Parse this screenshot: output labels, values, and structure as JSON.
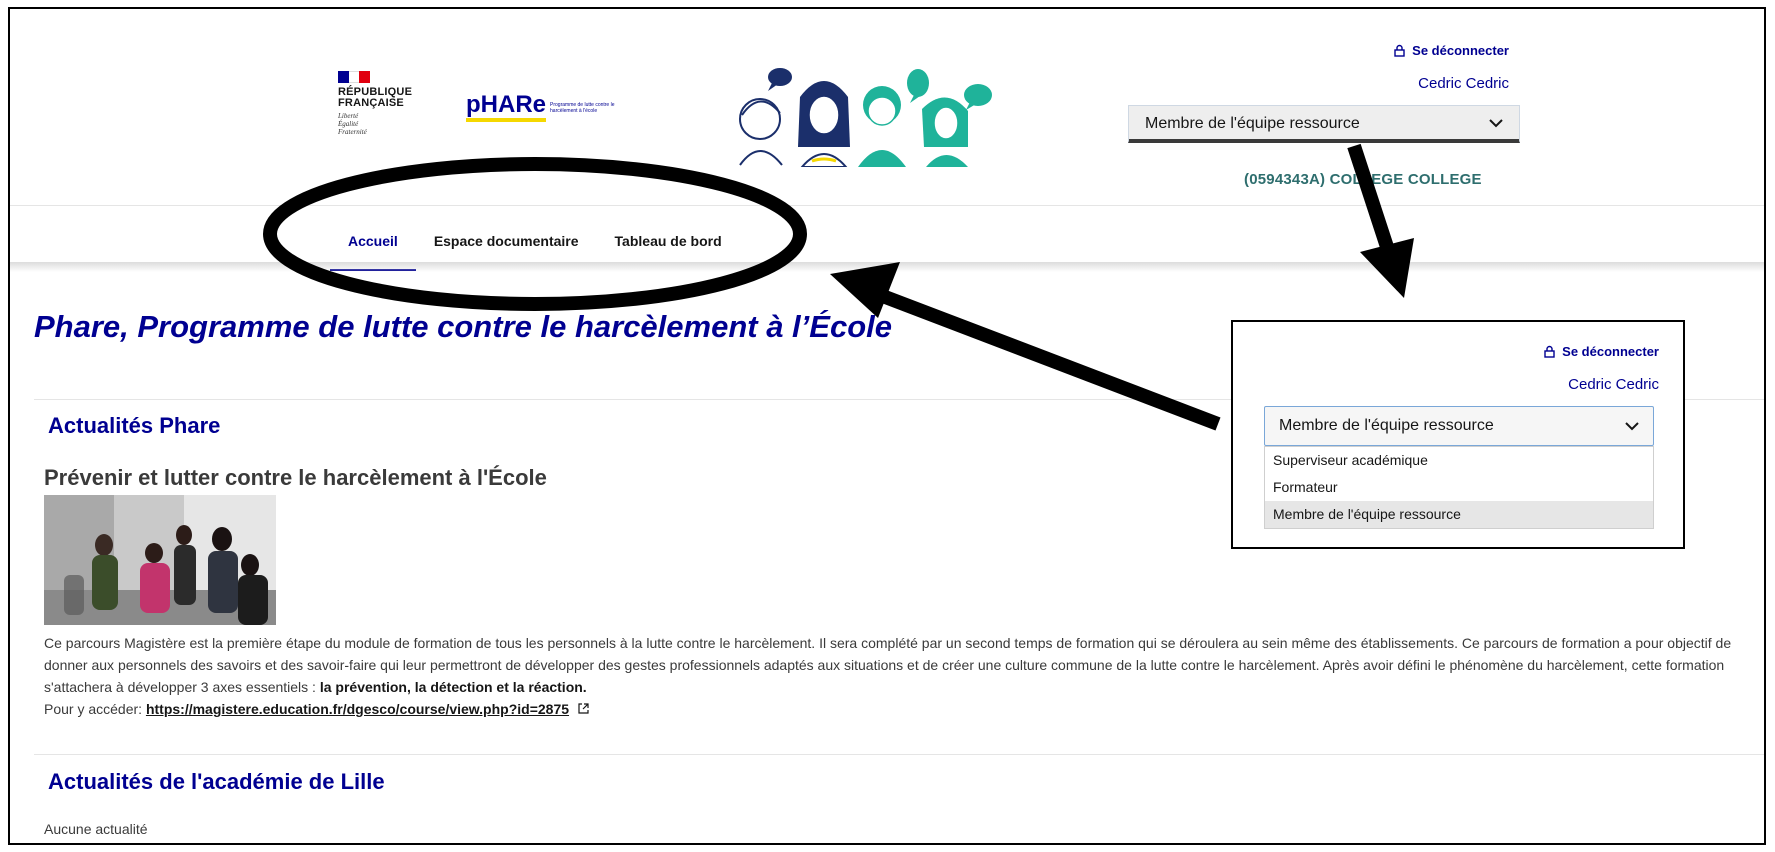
{
  "header": {
    "republic_name_line1": "RÉPUBLIQUE",
    "republic_name_line2": "FRANÇAISE",
    "republic_motto": [
      "Liberté",
      "Égalité",
      "Fraternité"
    ],
    "phare_logo_word": "pHARe",
    "phare_logo_tagline": "Programme de lutte contre le harcèlement à l'école",
    "logout_label": "Se déconnecter",
    "user_name": "Cedric Cedric",
    "role_selected": "Membre de l'équipe ressource",
    "establishment": "(0594343A) COLLEGE COLLEGE"
  },
  "nav": {
    "items": [
      {
        "label": "Accueil",
        "active": true
      },
      {
        "label": "Espace documentaire",
        "active": false
      },
      {
        "label": "Tableau de bord",
        "active": false
      }
    ]
  },
  "main": {
    "page_title": "Phare, Programme de lutte contre le harcèlement à l’École",
    "news_heading": "Actualités Phare",
    "article_title": "Prévenir et lutter contre le harcèlement à l'École",
    "article_text_1": "Ce parcours Magistère est la première étape du module de formation de tous les personnels à la lutte contre le harcèlement. Il sera complété par un second temps de formation qui se déroulera au sein même des établissements. Ce parcours de formation a pour objectif de donner aux personnels des savoirs et des savoir-faire qui leur permettront de développer des gestes professionnels adaptés aux situations et de créer une culture commune de la lutte contre le harcèlement. Après avoir défini le phénomène du harcèlement, cette formation s'attachera à développer 3 axes essentiels : ",
    "article_text_bold": "la prévention, la détection et la réaction.",
    "access_label": "Pour y accéder: ",
    "access_link": "https://magistere.education.fr/dgesco/course/view.php?id=2875",
    "lille_heading": "Actualités de l'académie de Lille",
    "lille_empty": "Aucune actualité"
  },
  "zoom_panel": {
    "logout_label": "Se déconnecter",
    "user_name": "Cedric Cedric",
    "role_selected": "Membre de l'équipe ressource",
    "role_options": [
      "Superviseur académique",
      "Formateur",
      "Membre de l'équipe ressource"
    ]
  },
  "colors": {
    "brand_blue": "#000091",
    "establishment_teal": "#2e6e6e",
    "illustration_teal": "#1fb39a",
    "logo_yellow": "#f5d800",
    "annotation_black": "#000000"
  }
}
